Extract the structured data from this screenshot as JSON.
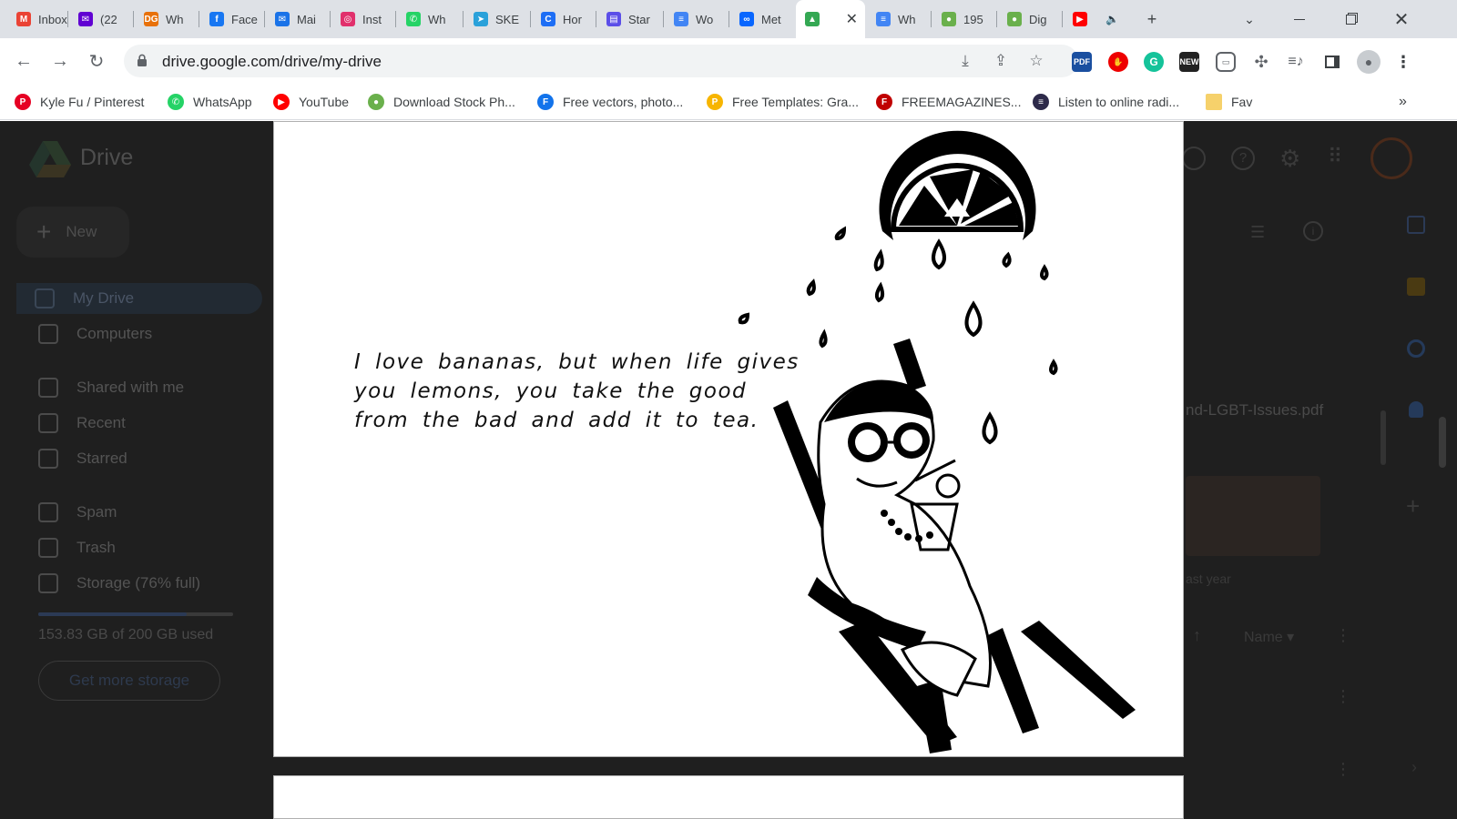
{
  "tabs": [
    {
      "title": "Inbox",
      "icon": "gmail-icon",
      "color": "#ea4335",
      "glyph": "M"
    },
    {
      "title": "(22",
      "icon": "yahoo-mail-icon",
      "color": "#6001d2",
      "glyph": "✉"
    },
    {
      "title": "Wh",
      "icon": "dg-icon",
      "color": "#e8710a",
      "glyph": "DG"
    },
    {
      "title": "Face",
      "icon": "facebook-icon",
      "color": "#1877f2",
      "glyph": "f"
    },
    {
      "title": "Mai",
      "icon": "mail-icon",
      "color": "#1a73e8",
      "glyph": "✉"
    },
    {
      "title": "Inst",
      "icon": "instagram-icon",
      "color": "#e1306c",
      "glyph": "◎"
    },
    {
      "title": "Wh",
      "icon": "whatsapp-icon",
      "color": "#25d366",
      "glyph": "✆"
    },
    {
      "title": "SKE",
      "icon": "telegram-icon",
      "color": "#2aa1da",
      "glyph": "➤"
    },
    {
      "title": "Hor",
      "icon": "canva-icon",
      "color": "#1d6ef5",
      "glyph": "C"
    },
    {
      "title": "Star",
      "icon": "sheets-icon",
      "color": "#5b4ee8",
      "glyph": "▤"
    },
    {
      "title": "Wo",
      "icon": "docs-icon",
      "color": "#4285f4",
      "glyph": "≡"
    },
    {
      "title": "Met",
      "icon": "meta-icon",
      "color": "#0866ff",
      "glyph": "∞"
    },
    {
      "title": "",
      "icon": "google-drive-icon",
      "color": "#34a853",
      "glyph": "▲",
      "active": true
    },
    {
      "title": "Wh",
      "icon": "docs-icon",
      "color": "#4285f4",
      "glyph": "≡"
    },
    {
      "title": "195",
      "icon": "leaf-icon",
      "color": "#6ab04c",
      "glyph": "●"
    },
    {
      "title": "Dig",
      "icon": "leaf-icon",
      "color": "#6ab04c",
      "glyph": "●"
    },
    {
      "title": "",
      "icon": "youtube-icon",
      "color": "#ff0000",
      "glyph": "▶",
      "audio": true
    }
  ],
  "toolbar": {
    "url": "drive.google.com/drive/my-drive"
  },
  "bookmarks": [
    {
      "label": "Kyle Fu / Pinterest",
      "icon": "pinterest-icon",
      "color": "#e60023",
      "glyph": "P"
    },
    {
      "label": "WhatsApp",
      "icon": "whatsapp-icon",
      "color": "#25d366",
      "glyph": "✆"
    },
    {
      "label": "YouTube",
      "icon": "youtube-icon",
      "color": "#ff0000",
      "glyph": "▶"
    },
    {
      "label": "Download Stock Ph...",
      "icon": "leaf-icon",
      "color": "#6ab04c",
      "glyph": "●"
    },
    {
      "label": "Free vectors, photo...",
      "icon": "freepik-icon",
      "color": "#1273eb",
      "glyph": "F"
    },
    {
      "label": "Free Templates: Gra...",
      "icon": "template-icon",
      "color": "#f7b500",
      "glyph": "P"
    },
    {
      "label": "FREEMAGAZINES...",
      "icon": "freemagazines-icon",
      "color": "#c00000",
      "glyph": "F"
    },
    {
      "label": "Listen to online radi...",
      "icon": "radio-flag-icon",
      "color": "#2d2a4a",
      "glyph": "≡"
    },
    {
      "label": "Fav",
      "icon": "folder-icon",
      "color": "#f6d16b",
      "glyph": ""
    }
  ],
  "drive": {
    "app_name": "Drive",
    "new_label": "New",
    "nav": [
      {
        "label": "My Drive",
        "icon": "my-drive-icon",
        "selected": true
      },
      {
        "label": "Computers",
        "icon": "computers-icon"
      },
      {
        "label": "Shared with me",
        "icon": "shared-icon"
      },
      {
        "label": "Recent",
        "icon": "recent-icon"
      },
      {
        "label": "Starred",
        "icon": "star-icon"
      },
      {
        "label": "Spam",
        "icon": "spam-icon"
      },
      {
        "label": "Trash",
        "icon": "trash-icon"
      },
      {
        "label": "Storage (76% full)",
        "icon": "cloud-icon"
      }
    ],
    "storage_used_fraction": 0.76,
    "storage_text": "153.83 GB of 200 GB used",
    "get_storage_label": "Get more storage",
    "file_name_partial": "nd-LGBT-Issues.pdf",
    "modified_partial": "ast year",
    "sort_label": "Name"
  },
  "preview": {
    "quote_lines": [
      "I love bananas, but when life gives",
      "you lemons, you take the good",
      "from the bad and add it to tea."
    ]
  }
}
